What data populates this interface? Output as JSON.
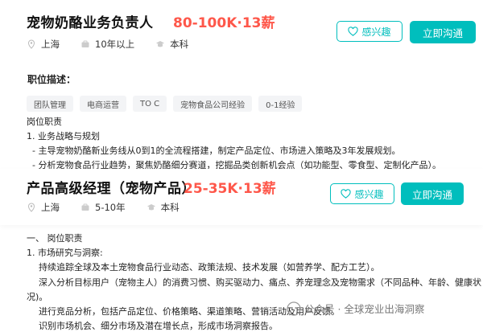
{
  "job1": {
    "title": "宠物奶酪业务负责人",
    "salary": "80-100K·13薪",
    "location": "上海",
    "experience": "10年以上",
    "education": "本科",
    "interest_label": "感兴趣",
    "chat_label": "立即沟通"
  },
  "description": {
    "heading": "职位描述：",
    "tags": [
      "团队管理",
      "电商运营",
      "TO C",
      "宠物食品公司经验",
      "0-1经验"
    ],
    "lines": [
      "岗位职责",
      "1. 业务战略与规划",
      "- 主导宠物奶酪新业务线从0到1的全流程搭建，制定产品定位、市场进入策略及3年发展规划。",
      "- 分析宠物食品行业趋势，聚焦奶酪细分赛道，挖掘品类创新机会点（如功能型、零食型、定制化产品）。"
    ]
  },
  "job2": {
    "title": "产品高级经理（宠物产品）",
    "salary": "25-35K·13薪",
    "location": "上海",
    "experience": "5-10年",
    "education": "本科",
    "interest_label": "感兴趣",
    "chat_label": "立即沟通"
  },
  "description2": {
    "lines": [
      "一、 岗位职责",
      "1. 市场研究与洞察:",
      "持续追踪全球及本土宠物食品行业动态、政策法规、技术发展（如营养学、配方工艺）。",
      "深入分析目标用户（宠物主人）的消费习惯、购买驱动力、痛点、养宠理念及宠物需求（不同品种、年龄、健康状",
      "况)。",
      "进行竞品分析，包括产品定位、价格策略、渠道策略、营销活动及用户反馈。",
      "识别市场机会、细分市场及潜在增长点，形成市场洞察报告。"
    ]
  },
  "watermark": {
    "text": "公众号 · 全球宠业出海洞察"
  },
  "colors": {
    "accent": "#00bebd",
    "salary": "#fe574a"
  }
}
